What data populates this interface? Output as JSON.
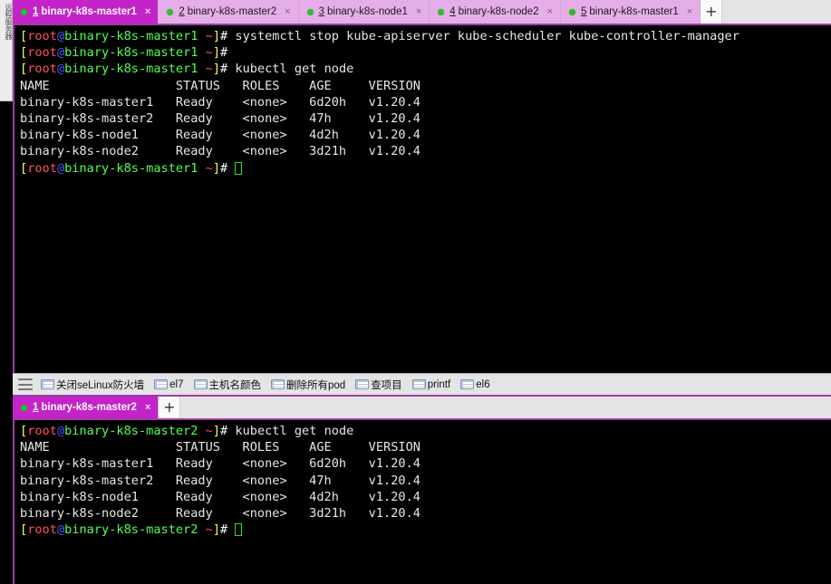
{
  "sidebar": {
    "vertical_label": "远程服务器"
  },
  "top_panel": {
    "tabs": [
      {
        "num": "1",
        "label": "binary-k8s-master1",
        "active": true,
        "close": "×",
        "status_color": "#22c522"
      },
      {
        "num": "2",
        "label": "binary-k8s-master2",
        "active": false,
        "close": "×",
        "status_color": "#22c522"
      },
      {
        "num": "3",
        "label": "binary-k8s-node1",
        "active": false,
        "close": "×",
        "status_color": "#22c522"
      },
      {
        "num": "4",
        "label": "binary-k8s-node2",
        "active": false,
        "close": "×",
        "status_color": "#22c522"
      },
      {
        "num": "5",
        "label": "binary-k8s-master1",
        "active": false,
        "close": "×",
        "status_color": "#22c522"
      }
    ],
    "add_tab_label": "+",
    "terminal": {
      "prompt": {
        "open_bracket": "[",
        "user": "root",
        "at": "@",
        "host": "binary-k8s-master1",
        "path": " ~",
        "close_bracket": "]",
        "hash": "#"
      },
      "lines": [
        {
          "type": "prompt",
          "command": " systemctl stop kube-apiserver kube-scheduler kube-controller-manager"
        },
        {
          "type": "prompt",
          "command": ""
        },
        {
          "type": "prompt",
          "command": " kubectl get node"
        },
        {
          "type": "output",
          "text": "NAME                 STATUS   ROLES    AGE     VERSION"
        },
        {
          "type": "output",
          "text": "binary-k8s-master1   Ready    <none>   6d20h   v1.20.4"
        },
        {
          "type": "output",
          "text": "binary-k8s-master2   Ready    <none>   47h     v1.20.4"
        },
        {
          "type": "output",
          "text": "binary-k8s-node1     Ready    <none>   4d2h    v1.20.4"
        },
        {
          "type": "output",
          "text": "binary-k8s-node2     Ready    <none>   3d21h   v1.20.4"
        },
        {
          "type": "prompt-cursor",
          "command": " "
        }
      ],
      "node_table": {
        "type": "table",
        "columns": [
          "NAME",
          "STATUS",
          "ROLES",
          "AGE",
          "VERSION"
        ],
        "rows": [
          [
            "binary-k8s-master1",
            "Ready",
            "<none>",
            "6d20h",
            "v1.20.4"
          ],
          [
            "binary-k8s-master2",
            "Ready",
            "<none>",
            "47h",
            "v1.20.4"
          ],
          [
            "binary-k8s-node1",
            "Ready",
            "<none>",
            "4d2h",
            "v1.20.4"
          ],
          [
            "binary-k8s-node2",
            "Ready",
            "<none>",
            "3d21h",
            "v1.20.4"
          ]
        ]
      }
    }
  },
  "bookmark_bar": {
    "menu_icon": "hamburger-icon",
    "items": [
      {
        "icon": "keyboard-icon",
        "label": "关闭seLinux防火墙"
      },
      {
        "icon": "keyboard-icon",
        "label": "el7"
      },
      {
        "icon": "keyboard-icon",
        "label": "主机名颜色"
      },
      {
        "icon": "keyboard-icon",
        "label": "删除所有pod"
      },
      {
        "icon": "keyboard-icon",
        "label": "查项目"
      },
      {
        "icon": "keyboard-icon",
        "label": "printf"
      },
      {
        "icon": "keyboard-icon",
        "label": "el6"
      }
    ]
  },
  "bottom_panel": {
    "tabs": [
      {
        "num": "1",
        "label": "binary-k8s-master2",
        "active": true,
        "close": "×",
        "status_color": "#22c522"
      }
    ],
    "add_tab_label": "+",
    "terminal": {
      "prompt": {
        "open_bracket": "[",
        "user": "root",
        "at": "@",
        "host": "binary-k8s-master2",
        "path": " ~",
        "close_bracket": "]",
        "hash": "#"
      },
      "lines": [
        {
          "type": "prompt",
          "command": " kubectl get node"
        },
        {
          "type": "output",
          "text": "NAME                 STATUS   ROLES    AGE     VERSION"
        },
        {
          "type": "output",
          "text": "binary-k8s-master1   Ready    <none>   6d20h   v1.20.4"
        },
        {
          "type": "output",
          "text": "binary-k8s-master2   Ready    <none>   47h     v1.20.4"
        },
        {
          "type": "output",
          "text": "binary-k8s-node1     Ready    <none>   4d2h    v1.20.4"
        },
        {
          "type": "output",
          "text": "binary-k8s-node2     Ready    <none>   3d21h   v1.20.4"
        },
        {
          "type": "prompt-cursor",
          "command": " "
        }
      ],
      "node_table": {
        "type": "table",
        "columns": [
          "NAME",
          "STATUS",
          "ROLES",
          "AGE",
          "VERSION"
        ],
        "rows": [
          [
            "binary-k8s-master1",
            "Ready",
            "<none>",
            "6d20h",
            "v1.20.4"
          ],
          [
            "binary-k8s-master2",
            "Ready",
            "<none>",
            "47h",
            "v1.20.4"
          ],
          [
            "binary-k8s-node1",
            "Ready",
            "<none>",
            "4d2h",
            "v1.20.4"
          ],
          [
            "binary-k8s-node2",
            "Ready",
            "<none>",
            "3d21h",
            "v1.20.4"
          ]
        ]
      }
    }
  },
  "colors": {
    "tab_active_bg": "#c423c9",
    "tab_inactive_bg": "#e6aee9",
    "accent_border": "#9b3fa0",
    "chrome_bg": "#e4e4e4",
    "terminal_bg": "#000000",
    "prompt_user": "#ff5454",
    "prompt_host": "#54ff54",
    "prompt_bracket": "#ffff54",
    "cursor": "#2ee02e"
  }
}
